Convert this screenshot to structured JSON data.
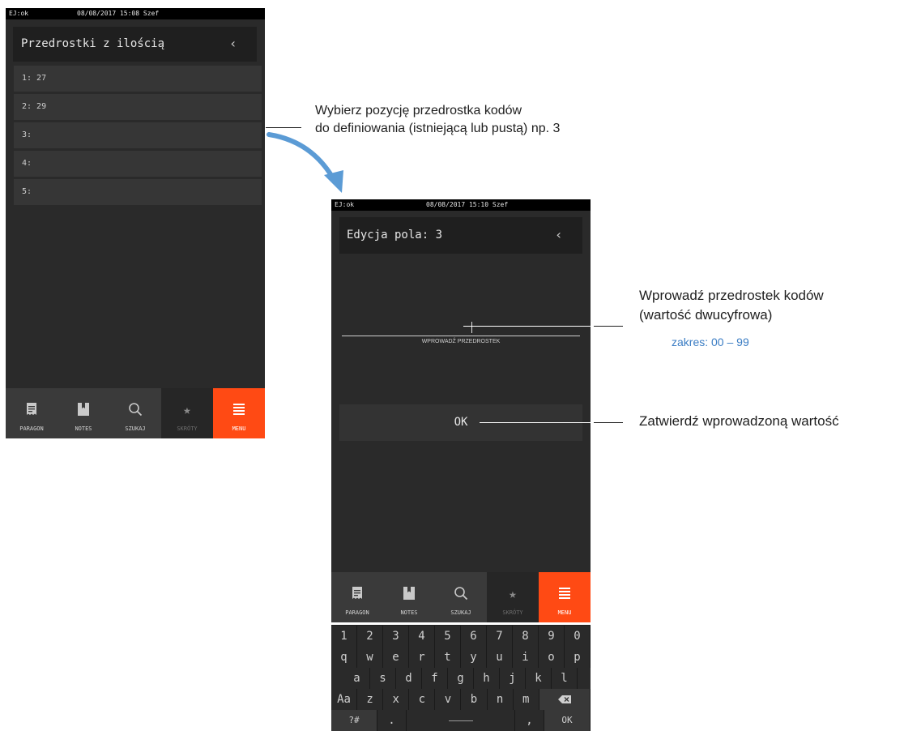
{
  "screen1": {
    "status": {
      "left": "EJ:ok",
      "center": "08/08/2017 15:08 Szef"
    },
    "title": "Przedrostki z ilością",
    "back_icon": "chevron-left-icon",
    "items": [
      {
        "label": "1: 27"
      },
      {
        "label": "2: 29"
      },
      {
        "label": "3:"
      },
      {
        "label": "4:"
      },
      {
        "label": "5:"
      }
    ]
  },
  "screen2": {
    "status": {
      "left": "EJ:ok",
      "center": "08/08/2017 15:10 Szef"
    },
    "title": "Edycja pola: 3",
    "back_icon": "chevron-left-icon",
    "input_value": "",
    "input_label": "WPROWADŹ PRZEDROSTEK",
    "ok_label": "OK"
  },
  "keyboard": {
    "row1": [
      "1",
      "2",
      "3",
      "4",
      "5",
      "6",
      "7",
      "8",
      "9",
      "0"
    ],
    "row2": [
      "q",
      "w",
      "e",
      "r",
      "t",
      "y",
      "u",
      "i",
      "o",
      "p"
    ],
    "row3": [
      "a",
      "s",
      "d",
      "f",
      "g",
      "h",
      "j",
      "k",
      "l"
    ],
    "row4": [
      "Aa",
      "z",
      "x",
      "c",
      "v",
      "b",
      "n",
      "m"
    ],
    "backspace_icon": "backspace-icon",
    "symbols_key": "?#",
    "dot_key": ".",
    "comma_key": ",",
    "ok_key": "OK"
  },
  "nav": [
    {
      "label": "PARAGON",
      "icon": "receipt-icon"
    },
    {
      "label": "NOTES",
      "icon": "bookmark-icon"
    },
    {
      "label": "SZUKAJ",
      "icon": "search-icon"
    },
    {
      "label": "SKRÓTY",
      "icon": "star-icon"
    },
    {
      "label": "MENU",
      "icon": "menu-icon"
    }
  ],
  "annotations": {
    "a1_line1": "Wybierz pozycję przedrostka kodów",
    "a1_line2": "do definiowania (istniejącą lub pustą) np. 3",
    "a2_line1": "Wprowadź przedrostek kodów",
    "a2_line2": "(wartość dwucyfrowa)",
    "a2_range": "zakres: 00 – 99",
    "a3": "Zatwierdź wprowadzoną wartość"
  },
  "colors": {
    "accent": "#ff4a14",
    "annotation_blue": "#3b7dc4",
    "arrow": "#5b9bd5"
  }
}
